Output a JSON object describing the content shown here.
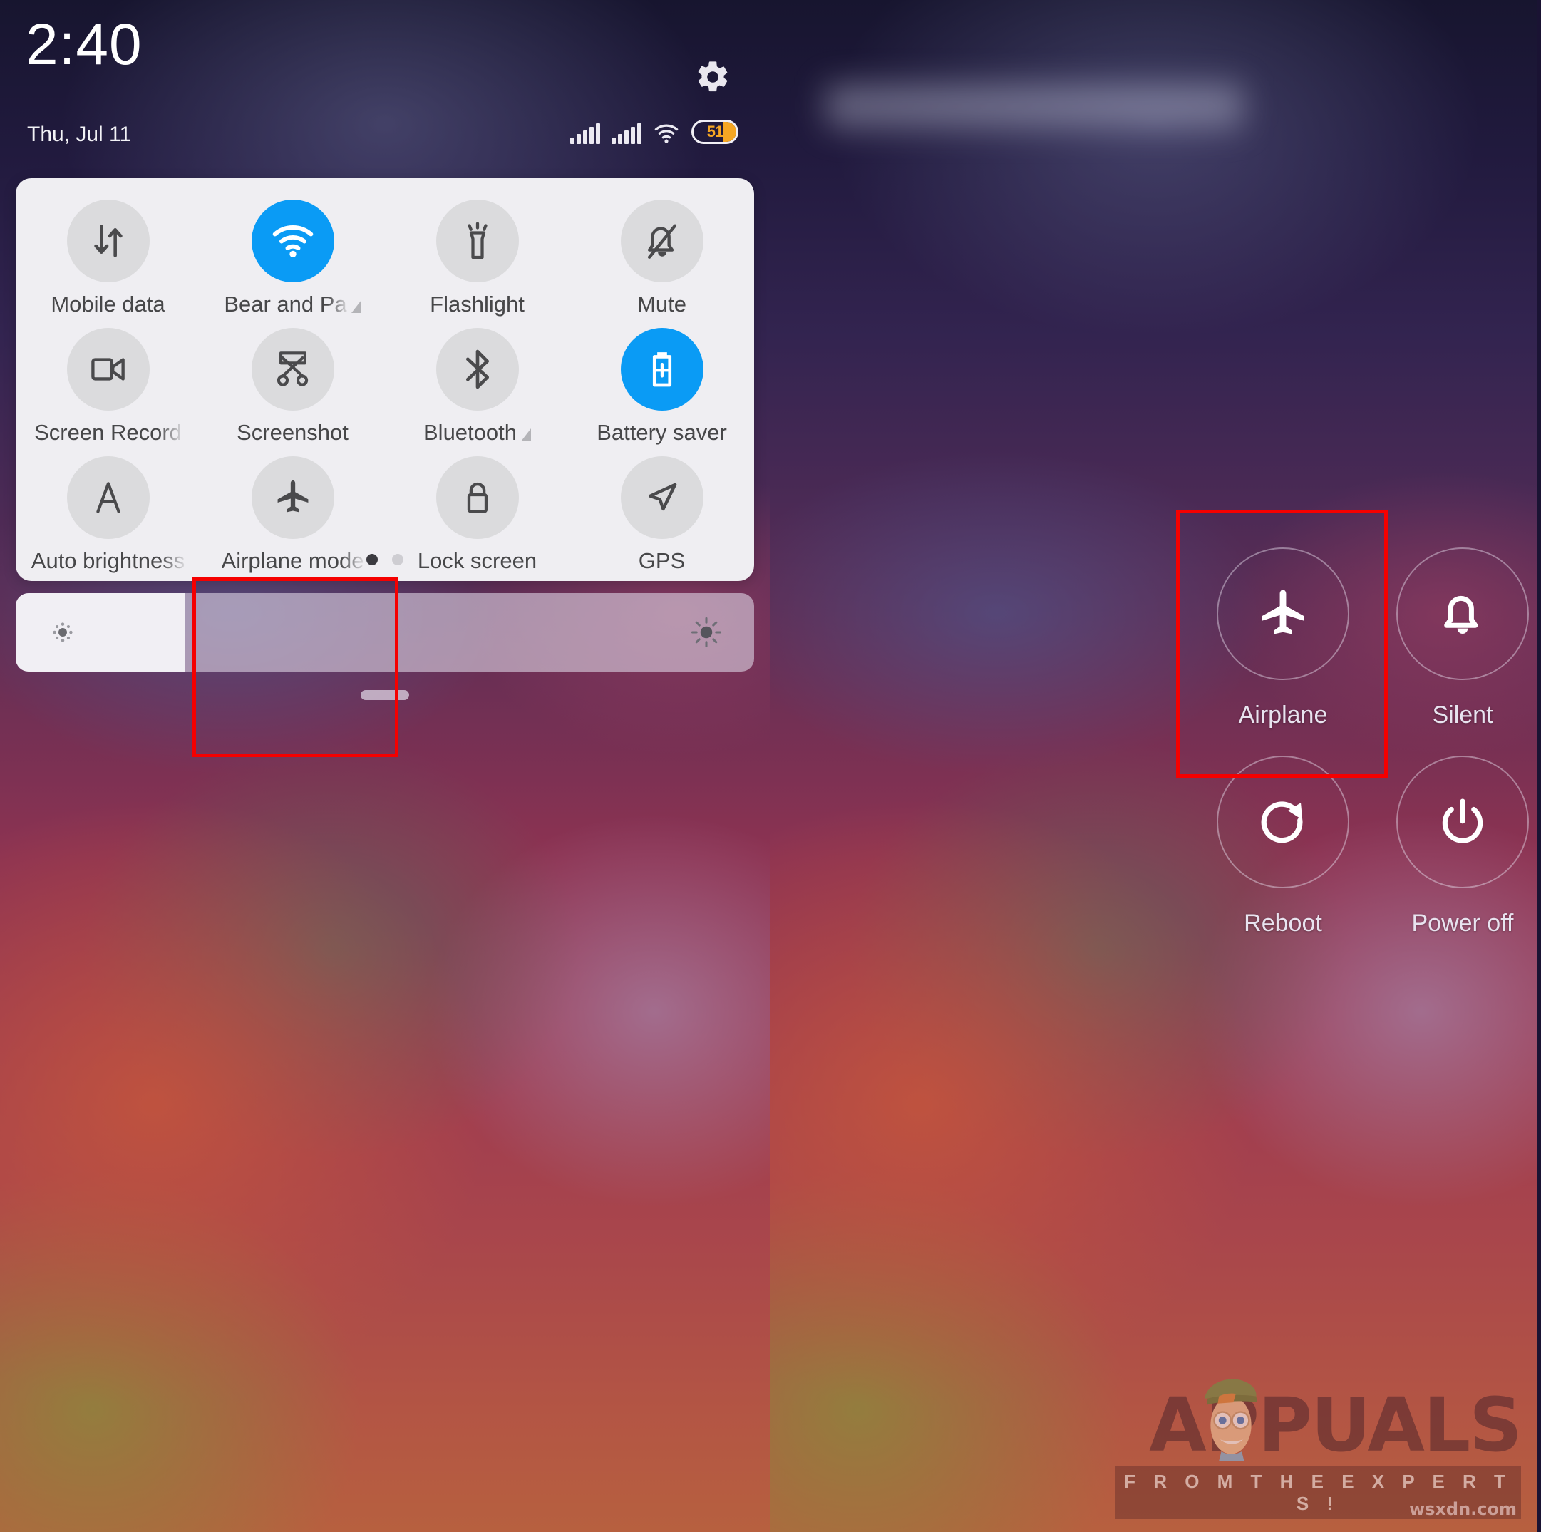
{
  "status_bar": {
    "time": "2:40",
    "date": "Thu, Jul 11",
    "settings_icon": "gear-icon",
    "signal_1_icon": "signal-bars-icon",
    "signal_2_icon": "signal-bars-icon",
    "wifi_icon": "wifi-icon",
    "battery_percent": "51",
    "battery_level": 51,
    "battery_color": "#f5a623"
  },
  "quick_settings": {
    "active_color": "#0a9bf5",
    "tiles": [
      {
        "label": "Mobile data",
        "icon": "mobile-data-icon",
        "active": false,
        "truncated": false,
        "has_arrow": false
      },
      {
        "label": "Bear and Pa",
        "icon": "wifi-icon",
        "active": true,
        "truncated": true,
        "has_arrow": true
      },
      {
        "label": "Flashlight",
        "icon": "flashlight-icon",
        "active": false,
        "truncated": false,
        "has_arrow": false
      },
      {
        "label": "Mute",
        "icon": "bell-muted-icon",
        "active": false,
        "truncated": false,
        "has_arrow": false
      },
      {
        "label": "Screen Record",
        "icon": "video-camera-icon",
        "active": false,
        "truncated": true,
        "has_arrow": false
      },
      {
        "label": "Screenshot",
        "icon": "scissors-icon",
        "active": false,
        "truncated": false,
        "has_arrow": false
      },
      {
        "label": "Bluetooth",
        "icon": "bluetooth-icon",
        "active": false,
        "truncated": false,
        "has_arrow": true
      },
      {
        "label": "Battery saver",
        "icon": "battery-plus-icon",
        "active": true,
        "truncated": false,
        "has_arrow": false
      },
      {
        "label": "Auto brightness",
        "icon": "auto-brightness-icon",
        "active": false,
        "truncated": true,
        "has_arrow": false
      },
      {
        "label": "Airplane mode",
        "icon": "airplane-icon",
        "active": false,
        "truncated": true,
        "has_arrow": false
      },
      {
        "label": "Lock screen",
        "icon": "lock-icon",
        "active": false,
        "truncated": false,
        "has_arrow": false
      },
      {
        "label": "GPS",
        "icon": "navigation-arrow-icon",
        "active": false,
        "truncated": false,
        "has_arrow": false
      }
    ],
    "pages": 2,
    "active_page": 1
  },
  "brightness": {
    "value_percent": 23,
    "low_icon": "brightness-low-icon",
    "high_icon": "brightness-high-icon"
  },
  "highlights": {
    "left_target": "Airplane mode",
    "right_target": "Airplane",
    "color": "#f50000"
  },
  "power_menu": {
    "items": [
      {
        "label": "Airplane",
        "icon": "airplane-icon"
      },
      {
        "label": "Silent",
        "icon": "bell-icon"
      },
      {
        "label": "Reboot",
        "icon": "reboot-circular-arrow-icon"
      },
      {
        "label": "Power off",
        "icon": "power-icon"
      }
    ]
  },
  "watermark": {
    "brand": "APPUALS",
    "tagline": "F R O M   T H E   E X P E R T S !",
    "site": "wsxdn.com"
  }
}
